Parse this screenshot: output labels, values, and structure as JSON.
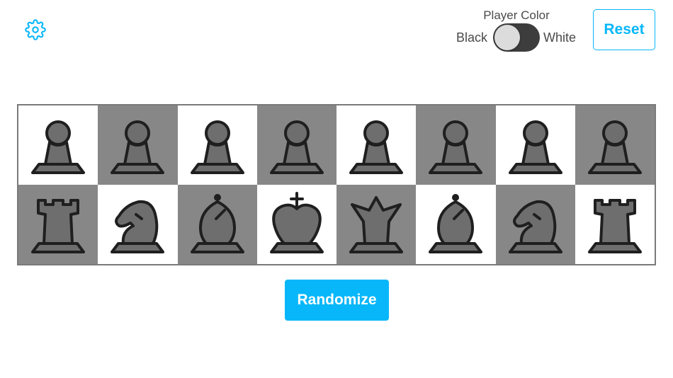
{
  "colors": {
    "accent": "#08b7fa",
    "light_square": "#ffffff",
    "dark_square": "#878787",
    "piece_fill": "#6e6e6e",
    "piece_stroke": "#1f1f1f",
    "toggle_track": "#3d3d3d"
  },
  "header": {
    "settings_icon": "gear-icon",
    "player_color": {
      "title": "Player Color",
      "left_option": "Black",
      "right_option": "White",
      "selected": "Black"
    },
    "reset_label": "Reset"
  },
  "board": {
    "ranks": [
      {
        "squares": [
          {
            "piece": "pawn",
            "shade": "light"
          },
          {
            "piece": "pawn",
            "shade": "dark"
          },
          {
            "piece": "pawn",
            "shade": "light"
          },
          {
            "piece": "pawn",
            "shade": "dark"
          },
          {
            "piece": "pawn",
            "shade": "light"
          },
          {
            "piece": "pawn",
            "shade": "dark"
          },
          {
            "piece": "pawn",
            "shade": "light"
          },
          {
            "piece": "pawn",
            "shade": "dark"
          }
        ]
      },
      {
        "squares": [
          {
            "piece": "rook",
            "shade": "dark"
          },
          {
            "piece": "knight",
            "shade": "light"
          },
          {
            "piece": "bishop",
            "shade": "dark"
          },
          {
            "piece": "king",
            "shade": "light"
          },
          {
            "piece": "queen",
            "shade": "dark"
          },
          {
            "piece": "bishop",
            "shade": "light"
          },
          {
            "piece": "knight",
            "shade": "dark"
          },
          {
            "piece": "rook",
            "shade": "light"
          }
        ]
      }
    ]
  },
  "randomize_label": "Randomize"
}
